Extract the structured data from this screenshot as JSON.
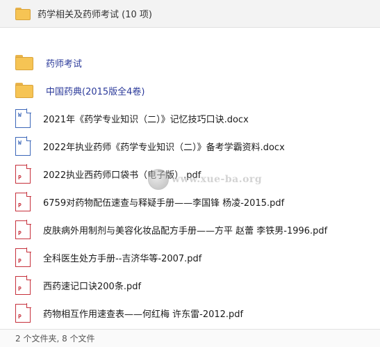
{
  "header": {
    "title": "药学相关及药师考试 (10 项)",
    "icon": "folder-icon"
  },
  "items": [
    {
      "name": "药师考试",
      "type": "folder",
      "icon": "folder-icon"
    },
    {
      "name": "中国药典(2015版全4卷)",
      "type": "folder",
      "icon": "folder-icon"
    },
    {
      "name": "2021年《药学专业知识（二）》记忆技巧口诀.docx",
      "type": "docx",
      "icon": "word-document-icon"
    },
    {
      "name": "2022年执业药师《药学专业知识（二）》备考学霸资料.docx",
      "type": "docx",
      "icon": "word-document-icon"
    },
    {
      "name": "2022执业西药师口袋书（电子版）.pdf",
      "type": "pdf",
      "icon": "pdf-document-icon"
    },
    {
      "name": "6759对药物配伍速查与释疑手册——李国锋 杨凌-2015.pdf",
      "type": "pdf",
      "icon": "pdf-document-icon"
    },
    {
      "name": "皮肤病外用制剂与美容化妆品配方手册——方平 赵蕾 李铁男-1996.pdf",
      "type": "pdf",
      "icon": "pdf-document-icon"
    },
    {
      "name": "全科医生处方手册--吉济华等-2007.pdf",
      "type": "pdf",
      "icon": "pdf-document-icon"
    },
    {
      "name": "西药速记口诀200条.pdf",
      "type": "pdf",
      "icon": "pdf-document-icon"
    },
    {
      "name": "药物相互作用速查表——何红梅 许东雷-2012.pdf",
      "type": "pdf",
      "icon": "pdf-document-icon"
    }
  ],
  "status": {
    "summary": "2 个文件夹, 8 个文件"
  },
  "watermark": {
    "text": "www.xue-ba.org"
  },
  "colors": {
    "folder": "#f6c454",
    "docx_accent": "#3b66b8",
    "pdf_accent": "#c6303b",
    "folder_name_text": "#2b3a9a"
  }
}
